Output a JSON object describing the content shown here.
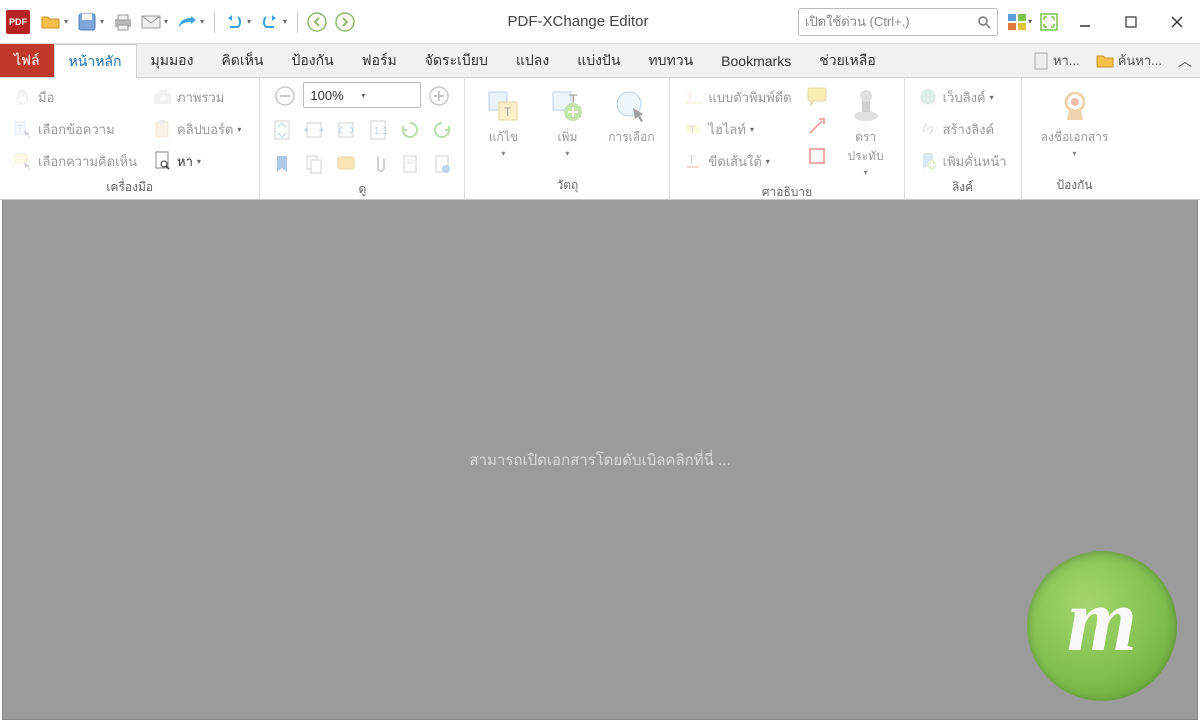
{
  "app": {
    "title": "PDF-XChange Editor",
    "icon_text": "PDF"
  },
  "quick_launch": {
    "placeholder": "เปิดใช้ด่วน (Ctrl+.)"
  },
  "tabs": {
    "file": "ไฟล์",
    "items": [
      "หน้าหลัก",
      "มุมมอง",
      "คิดเห็น",
      "ป้องกัน",
      "ฟอร์ม",
      "จัดระเบียบ",
      "แปลง",
      "แบ่งปัน",
      "ทบทวน",
      "Bookmarks",
      "ช่วยเหลือ"
    ],
    "active_index": 0,
    "right_tools": {
      "find": "หา...",
      "search": "ค้นหา..."
    }
  },
  "ribbon": {
    "tools": {
      "label": "เครื่องมือ",
      "hand": "มือ",
      "select_text": "เลือกข้อความ",
      "select_comments": "เลือกความคิดเห็น",
      "snapshot": "ภาพรวม",
      "clipboard": "คลิปบอร์ด",
      "find": "หา"
    },
    "view": {
      "label": "ดู",
      "zoom_value": "100%"
    },
    "objects": {
      "label": "วัตถุ",
      "edit": "แก้ไข",
      "add": "เพิ่ม",
      "select": "การเลือก"
    },
    "annotate": {
      "label": "ศาอธิบาย",
      "typewriter": "แบบตัวพิมพ์ดีด",
      "highlight": "ไฮไลท์",
      "underline": "ขีดเส้นใต้",
      "stamp": "ตราประทับ"
    },
    "links": {
      "label": "ลิงค์",
      "weblinks": "เว็บลิงค์",
      "create_link": "สร้างลิงค์",
      "bookmark": "เพิ่มคั่นหน้า"
    },
    "protect": {
      "label": "ป้องกัน",
      "sign": "ลงชื่อเอกสาร"
    }
  },
  "workspace": {
    "hint": "สามารถเปิดเอกสารโดยดับเบิลคลิกที่นี่ ..."
  },
  "watermark": {
    "letter": "m"
  }
}
